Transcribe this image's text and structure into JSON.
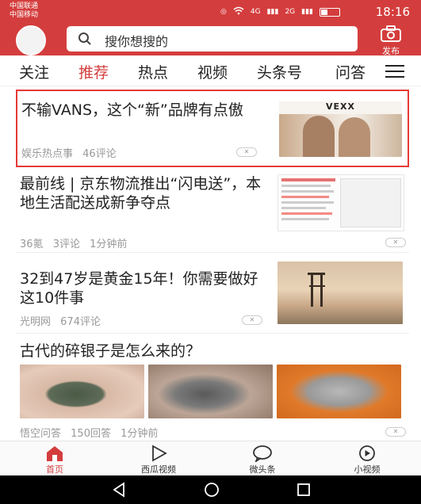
{
  "status": {
    "carrier1": "中国联通",
    "carrier2": "中国移动",
    "time": "18:16",
    "signal1": "4G",
    "signal2": "2G"
  },
  "header": {
    "search_placeholder": "搜你想搜的",
    "publish_label": "发布"
  },
  "tabs": [
    {
      "label": "关注"
    },
    {
      "label": "推荐"
    },
    {
      "label": "热点"
    },
    {
      "label": "视频"
    },
    {
      "label": "头条号"
    },
    {
      "label": "问答"
    }
  ],
  "articles": [
    {
      "title": "不输VANS，这个“新”品牌有点傲",
      "source": "娱乐热点事",
      "comments": "46评论",
      "brand_text": "VEXX"
    },
    {
      "title": "最前线 | 京东物流推出“闪电送”，本地生活配送成新争夺点",
      "source": "36氪",
      "comments": "3评论",
      "time": "1分钟前"
    },
    {
      "title": "32到47岁是黄金15年！你需要做好这10件事",
      "source": "光明网",
      "comments": "674评论"
    },
    {
      "title": "古代的碎银子是怎么来的？",
      "source": "悟空问答",
      "comments": "150回答",
      "time": "1分钟前"
    }
  ],
  "bottom_nav": [
    {
      "label": "首页",
      "icon": "home-icon"
    },
    {
      "label": "西瓜视频",
      "icon": "play-icon"
    },
    {
      "label": "微头条",
      "icon": "chat-bubble-icon"
    },
    {
      "label": "小视频",
      "icon": "small-video-icon"
    }
  ],
  "colors": {
    "brand_red": "#d43d3d",
    "highlight_border": "#e53935"
  }
}
